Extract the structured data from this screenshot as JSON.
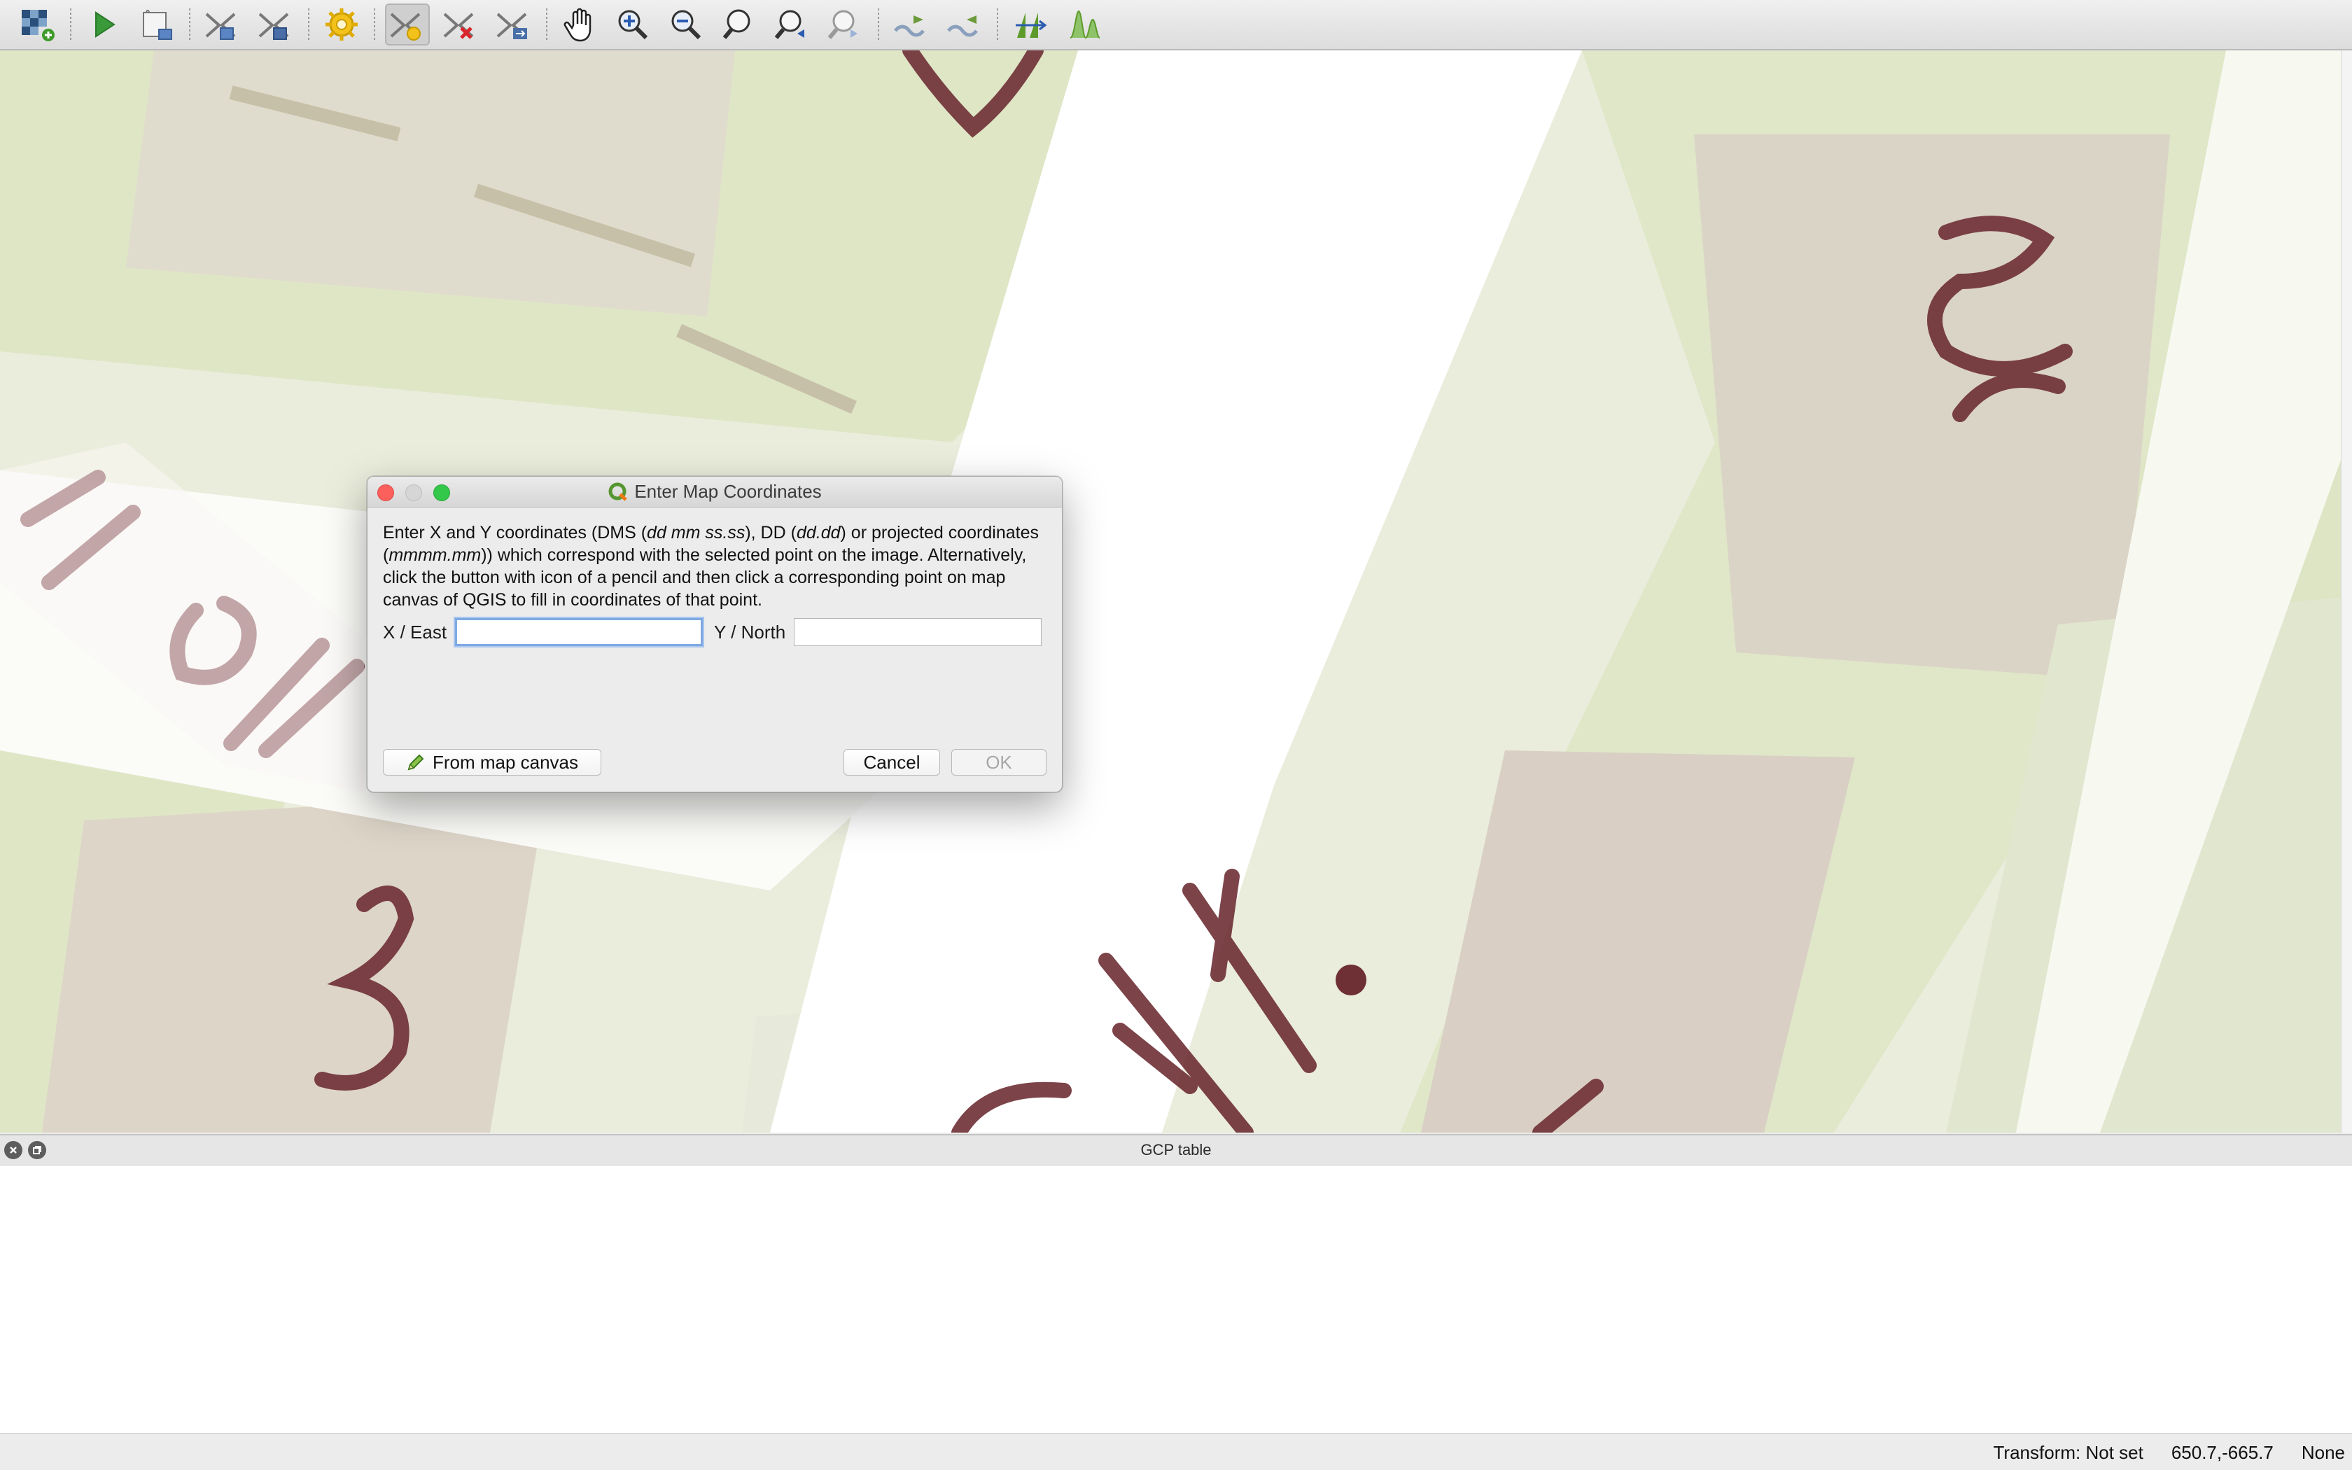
{
  "toolbar": {
    "buttons": [
      {
        "icon": "open-raster-icon",
        "active": false
      },
      {
        "icon": "start-georeferencing-icon",
        "active": false
      },
      {
        "icon": "generate-gdal-script-icon",
        "active": false
      },
      {
        "icon": "load-gcp-points-icon",
        "active": false
      },
      {
        "icon": "save-gcp-points-icon",
        "active": false
      },
      {
        "icon": "transformation-settings-icon",
        "active": false
      },
      {
        "icon": "add-point-icon",
        "active": true
      },
      {
        "icon": "delete-point-icon",
        "active": false
      },
      {
        "icon": "move-gcp-point-icon",
        "active": false
      },
      {
        "icon": "pan-icon",
        "active": false
      },
      {
        "icon": "zoom-in-icon",
        "active": false
      },
      {
        "icon": "zoom-out-icon",
        "active": false
      },
      {
        "icon": "zoom-to-layer-icon",
        "active": false
      },
      {
        "icon": "zoom-last-icon",
        "active": false
      },
      {
        "icon": "zoom-next-icon",
        "active": false
      },
      {
        "icon": "link-georeferencer-to-qgis-icon",
        "active": false
      },
      {
        "icon": "link-qgis-to-georeferencer-icon",
        "active": false
      },
      {
        "icon": "full-histogram-stretch-icon",
        "active": false
      },
      {
        "icon": "local-histogram-stretch-icon",
        "active": false
      }
    ]
  },
  "dialog": {
    "title": "Enter Map Coordinates",
    "description": {
      "p1": "Enter X and Y coordinates (DMS (",
      "e1": "dd mm ss.ss",
      "p2": "), DD (",
      "e2": "dd.dd",
      "p3": ") or projected coordinates (",
      "e3": "mmmm.mm",
      "p4": ")) which correspond with the selected point on the image. Alternatively, click the button with icon of a pencil and then click a corresponding point on map canvas of QGIS to fill in coordinates of that point."
    },
    "x_label": "X / East",
    "x_value": "",
    "y_label": "Y / North",
    "y_value": "",
    "from_map_canvas_label": "From map canvas",
    "cancel_label": "Cancel",
    "ok_label": "OK"
  },
  "gcp_table": {
    "title": "GCP table"
  },
  "statusbar": {
    "transform": "Transform: Not set",
    "coordinates": "650.7,-665.7",
    "crs": "None"
  },
  "colors": {
    "map_green": "#dfe6c6",
    "map_road": "#ffffff",
    "map_building": "#d9cfc4",
    "map_label": "#6e2f35",
    "accent_focus": "#7fa9e3"
  }
}
